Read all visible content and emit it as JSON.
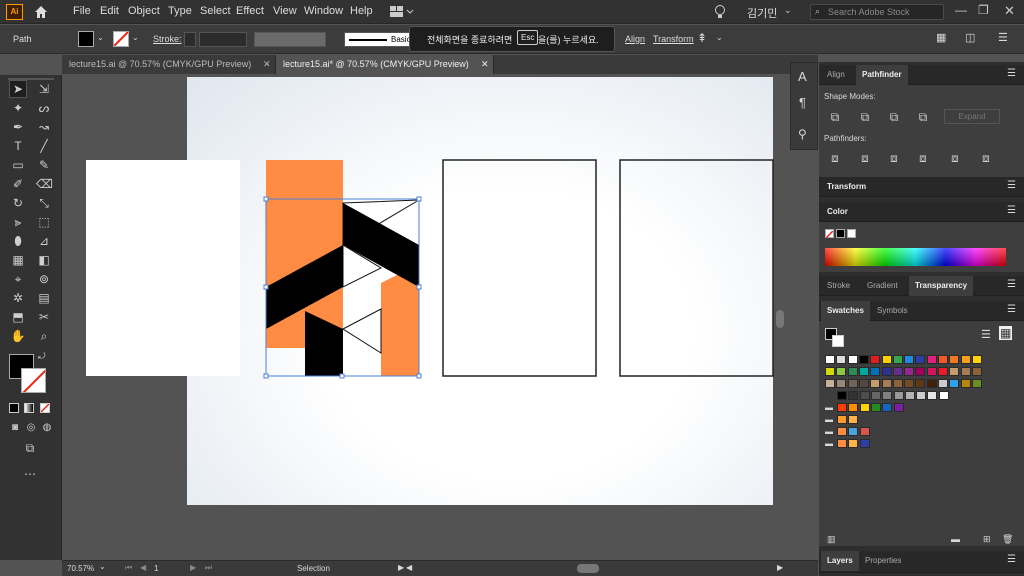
{
  "app": {
    "logo": "Ai"
  },
  "menu": [
    "File",
    "Edit",
    "Object",
    "Type",
    "Select",
    "Effect",
    "View",
    "Window",
    "Help"
  ],
  "user": {
    "name": "김기민"
  },
  "search": {
    "placeholder": "Search Adobe Stock"
  },
  "control": {
    "object_type": "Path",
    "stroke_label": "Stroke:",
    "brush": "Basic",
    "align_label": "Align",
    "transform_label": "Transform"
  },
  "toast": {
    "prefix": "전체화면을 종료하려면",
    "key": "Esc",
    "suffix": "을(를) 누르세요."
  },
  "tabs": [
    {
      "label": "lecture15.ai @ 70.57% (CMYK/GPU Preview)",
      "active": false
    },
    {
      "label": "lecture15.ai* @ 70.57% (CMYK/GPU Preview)",
      "active": true
    }
  ],
  "panels": {
    "align_tab": "Align",
    "pathfinder_tab": "Pathfinder",
    "shape_modes": "Shape Modes:",
    "expand": "Expand",
    "pathfinders": "Pathfinders:",
    "transform": "Transform",
    "color": "Color",
    "stroke_tab": "Stroke",
    "gradient_tab": "Gradient",
    "transparency_tab": "Transparency",
    "swatches_tab": "Swatches",
    "symbols_tab": "Symbols",
    "layers_tab": "Layers",
    "properties_tab": "Properties"
  },
  "status": {
    "zoom": "70.57%",
    "page": "1",
    "tool": "Selection"
  },
  "colors": {
    "accent": "#ff8c42",
    "black": "#000000",
    "artboard": "#ffffff"
  },
  "icons": [
    "selection-icon",
    "direct-selection-icon",
    "magic-wand-icon",
    "lasso-icon",
    "pen-icon",
    "curvature-icon",
    "type-icon",
    "line-icon",
    "rectangle-icon",
    "paintbrush-icon",
    "shaper-icon",
    "eraser-icon",
    "rotate-icon",
    "scale-icon",
    "width-icon",
    "free-transform-icon",
    "shape-builder-icon",
    "perspective-icon",
    "mesh-icon",
    "gradient-icon",
    "eyedropper-icon",
    "blend-icon",
    "symbol-sprayer-icon",
    "graph-icon",
    "artboard-icon",
    "slice-icon",
    "hand-icon",
    "zoom-icon"
  ]
}
